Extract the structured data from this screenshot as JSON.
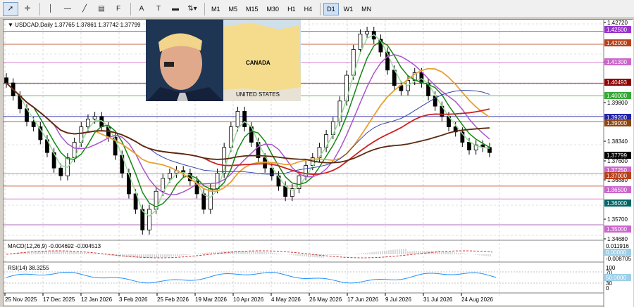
{
  "toolbar": {
    "tools": [
      {
        "name": "cursor-tool",
        "glyph": "➚",
        "active": true
      },
      {
        "name": "crosshair-tool",
        "glyph": "✛",
        "active": false
      },
      {
        "name": "vertical-line-tool",
        "glyph": "│",
        "active": false
      },
      {
        "name": "horizontal-line-tool",
        "glyph": "―",
        "active": false
      },
      {
        "name": "trendline-tool",
        "glyph": "╱",
        "active": false
      },
      {
        "name": "equidistant-channel-tool",
        "glyph": "▤",
        "active": false
      },
      {
        "name": "fibonacci-tool",
        "glyph": "F",
        "active": false
      },
      {
        "name": "text-tool",
        "glyph": "A",
        "active": false
      },
      {
        "name": "text-label-tool",
        "glyph": "T",
        "active": false
      },
      {
        "name": "rectangle-tool",
        "glyph": "▬",
        "active": false
      },
      {
        "name": "arrows-tool",
        "glyph": "⇅▾",
        "active": false
      }
    ],
    "timeframes": [
      "M1",
      "M5",
      "M15",
      "M30",
      "H1",
      "H4",
      "D1",
      "W1",
      "MN"
    ],
    "active_timeframe": "D1"
  },
  "header": {
    "symbol_label": "USDCAD,Daily",
    "ohlc": "1.37765 1.37861 1.37742 1.37799"
  },
  "price_axis": {
    "labels": [
      "1.42720",
      "1.41130",
      "1.39800",
      "1.38340",
      "1.37600",
      "1.36880",
      "1.35700",
      "1.34680"
    ],
    "boxes": [
      {
        "text": "1.42500",
        "color": "#9933cc"
      },
      {
        "text": "1.42000",
        "color": "#b8401a"
      },
      {
        "text": "1.41300",
        "color": "#cc66cc"
      },
      {
        "text": "1.40493",
        "color": "#8b0000"
      },
      {
        "text": "1.40000",
        "color": "#33aa33"
      },
      {
        "text": "1.39200",
        "color": "#2222aa"
      },
      {
        "text": "1.39000",
        "color": "#8b4513"
      },
      {
        "text": "1.37799",
        "color": "#000000"
      },
      {
        "text": "1.37250",
        "color": "#cc66cc"
      },
      {
        "text": "1.37000",
        "color": "#b8401a"
      },
      {
        "text": "1.36500",
        "color": "#cc66cc"
      },
      {
        "text": "1.36000",
        "color": "#006666"
      },
      {
        "text": "1.35000",
        "color": "#cc66cc"
      }
    ]
  },
  "macd": {
    "label": "MACD(12,26,9) -0.004692 -0.004513",
    "axis": [
      "0.011916",
      "0.00000",
      "-0.008705"
    ]
  },
  "rsi": {
    "label": "RSI(14) 38.3255",
    "axis": [
      "100",
      "70",
      "50.0000",
      "30",
      "0"
    ]
  },
  "time_axis": [
    "25 Nov 2025",
    "17 Dec 2025",
    "12 Jan 2026",
    "3 Feb 2026",
    "25 Feb 2026",
    "19 Mar 2026",
    "10 Apr 2026",
    "4 May 2026",
    "26 May 2026",
    "17 Jun 2026",
    "9 Jul 2026",
    "31 Jul 2026",
    "24 Aug 2026"
  ],
  "overlay": {
    "map_title": "CANADA",
    "map_subtitle": "UNITED STATES"
  },
  "chart_data": {
    "type": "candlestick",
    "symbol": "USDCAD",
    "timeframe": "Daily",
    "ylim": [
      1.344,
      1.429
    ],
    "closes": [
      1.405,
      1.4,
      1.395,
      1.39,
      1.388,
      1.383,
      1.378,
      1.372,
      1.369,
      1.376,
      1.382,
      1.388,
      1.391,
      1.392,
      1.388,
      1.384,
      1.377,
      1.37,
      1.362,
      1.356,
      1.348,
      1.356,
      1.363,
      1.368,
      1.37,
      1.371,
      1.37,
      1.367,
      1.362,
      1.356,
      1.364,
      1.37,
      1.38,
      1.388,
      1.394,
      1.388,
      1.382,
      1.376,
      1.372,
      1.369,
      1.365,
      1.361,
      1.364,
      1.369,
      1.373,
      1.376,
      1.38,
      1.385,
      1.39,
      1.398,
      1.408,
      1.418,
      1.424,
      1.425,
      1.422,
      1.417,
      1.41,
      1.404,
      1.402,
      1.406,
      1.409,
      1.405,
      1.4,
      1.396,
      1.392,
      1.388,
      1.386,
      1.382,
      1.379,
      1.381,
      1.38,
      1.378
    ],
    "levels": [
      1.425,
      1.42,
      1.413,
      1.40493,
      1.4,
      1.392,
      1.39,
      1.3725,
      1.37,
      1.365,
      1.36,
      1.35
    ],
    "last_price": 1.37799
  }
}
